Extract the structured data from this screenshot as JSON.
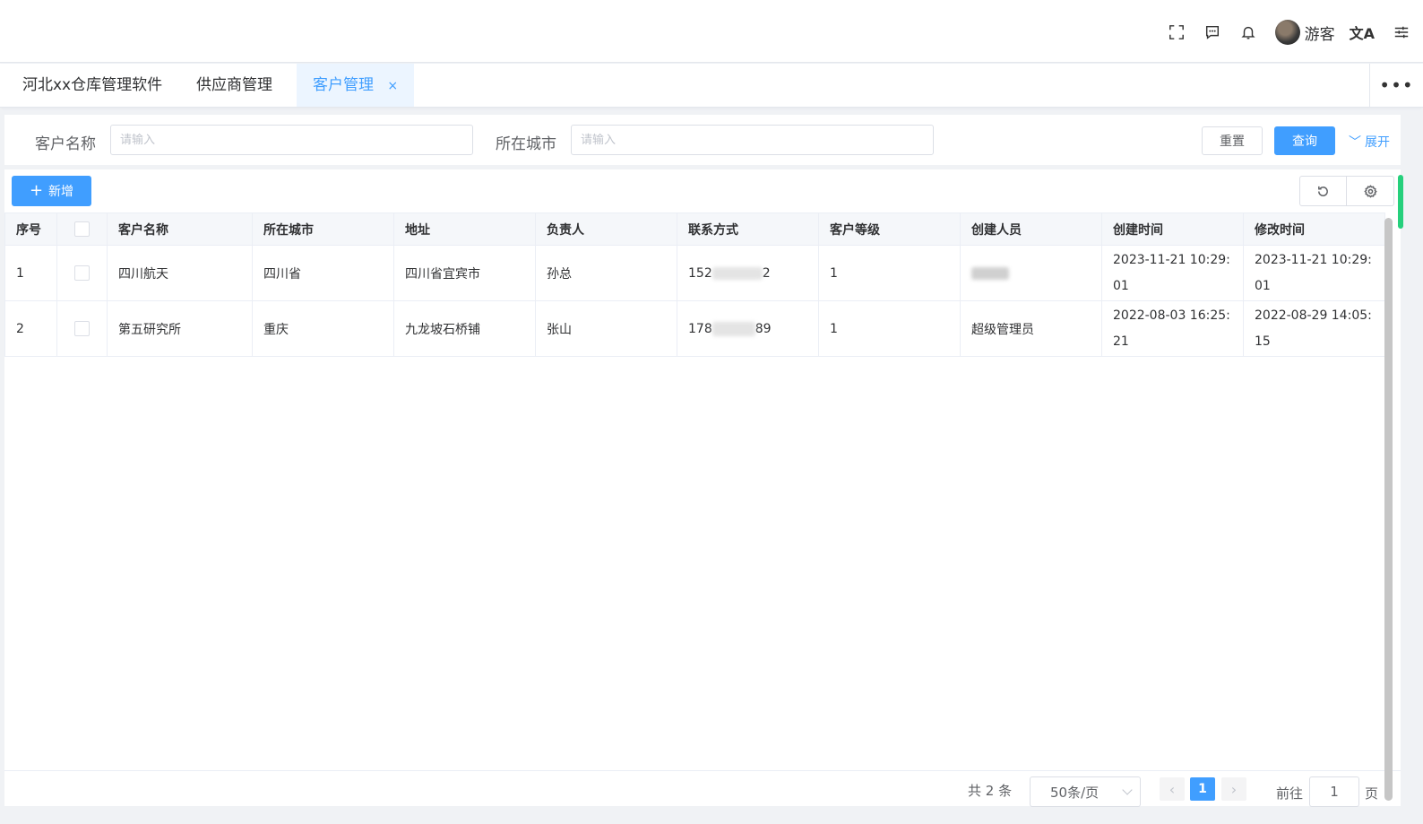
{
  "header": {
    "username": "游客",
    "lang_glyph": "文A"
  },
  "tabs": [
    {
      "label": "河北xx仓库管理软件"
    },
    {
      "label": "供应商管理"
    },
    {
      "label": "客户管理",
      "close": "×"
    }
  ],
  "tabs_more": "•••",
  "search": {
    "name_label": "客户名称",
    "name_placeholder": "请输入",
    "city_label": "所在城市",
    "city_placeholder": "请输入",
    "reset_label": "重置",
    "query_label": "查询",
    "expand_label": "展开"
  },
  "toolbar": {
    "add_label": "新增"
  },
  "table": {
    "columns": [
      "序号",
      "",
      "客户名称",
      "所在城市",
      "地址",
      "负责人",
      "联系方式",
      "客户等级",
      "创建人员",
      "创建时间",
      "修改时间"
    ],
    "rows": [
      {
        "index": "1",
        "name": "四川航天",
        "city": "四川省",
        "address": "四川省宜宾市",
        "manager": "孙总",
        "phone_prefix": "152",
        "phone_suffix": "2",
        "level": "1",
        "creator": "",
        "created": "2023-11-21 10:29:01",
        "modified": "2023-11-21 10:29:01"
      },
      {
        "index": "2",
        "name": "第五研究所",
        "city": "重庆",
        "address": "九龙坡石桥铺",
        "manager": "张山",
        "phone_prefix": "178",
        "phone_suffix": "89",
        "level": "1",
        "creator": "超级管理员",
        "created": "2022-08-03 16:25:21",
        "modified": "2022-08-29 14:05:15"
      }
    ]
  },
  "pagination": {
    "total_text": "共 2 条",
    "page_size": "50条/页",
    "current_page": "1",
    "goto_label": "前往",
    "goto_value": "1",
    "page_unit": "页"
  },
  "colors": {
    "primary": "#409eff",
    "active_tab_bg": "#ecf5ff"
  }
}
